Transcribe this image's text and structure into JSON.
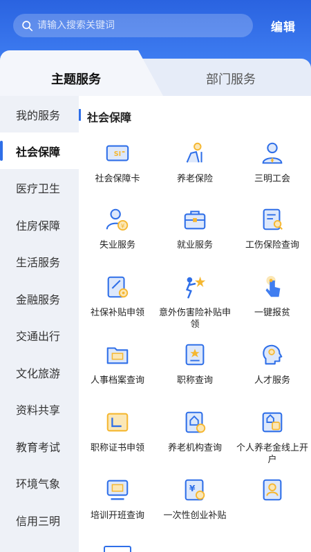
{
  "search": {
    "placeholder": "请输入搜索关键词"
  },
  "header": {
    "edit_label": "编辑"
  },
  "tabs": [
    {
      "label": "主题服务",
      "active": true
    },
    {
      "label": "部门服务",
      "active": false
    }
  ],
  "sidebar": {
    "items": [
      {
        "label": "我的服务"
      },
      {
        "label": "社会保障",
        "active": true
      },
      {
        "label": "医疗卫生"
      },
      {
        "label": "住房保障"
      },
      {
        "label": "生活服务"
      },
      {
        "label": "金融服务"
      },
      {
        "label": "交通出行"
      },
      {
        "label": "文化旅游"
      },
      {
        "label": "资料共享"
      },
      {
        "label": "教育考试"
      },
      {
        "label": "环境气象"
      },
      {
        "label": "信用三明"
      }
    ]
  },
  "section": {
    "title": "社会保障"
  },
  "services": [
    {
      "label": "社会保障卡",
      "icon": "social-security-card-icon"
    },
    {
      "label": "养老保险",
      "icon": "pension-insurance-icon"
    },
    {
      "label": "三明工会",
      "icon": "trade-union-icon"
    },
    {
      "label": "失业服务",
      "icon": "unemployment-icon"
    },
    {
      "label": "就业服务",
      "icon": "employment-briefcase-icon"
    },
    {
      "label": "工伤保险查询",
      "icon": "injury-insurance-query-icon"
    },
    {
      "label": "社保补贴申领",
      "icon": "subsidy-claim-icon"
    },
    {
      "label": "意外伤害险补贴申领",
      "icon": "accident-insurance-icon"
    },
    {
      "label": "一键报贫",
      "icon": "one-click-report-icon"
    },
    {
      "label": "人事档案查询",
      "icon": "personnel-file-icon"
    },
    {
      "label": "职称查询",
      "icon": "title-query-icon"
    },
    {
      "label": "人才服务",
      "icon": "talent-service-icon"
    },
    {
      "label": "职称证书申领",
      "icon": "certificate-claim-icon"
    },
    {
      "label": "养老机构查询",
      "icon": "elderly-institution-icon"
    },
    {
      "label": "个人养老金线上开户",
      "icon": "pension-account-icon"
    },
    {
      "label": "培训开班查询",
      "icon": "training-icon"
    },
    {
      "label": "一次性创业补贴",
      "icon": "startup-subsidy-icon"
    },
    {
      "label": "",
      "icon": "id-badge-icon"
    }
  ],
  "colors": {
    "primary": "#2f6fe8",
    "accent": "#f5b731",
    "header": "#3d7bf0"
  }
}
